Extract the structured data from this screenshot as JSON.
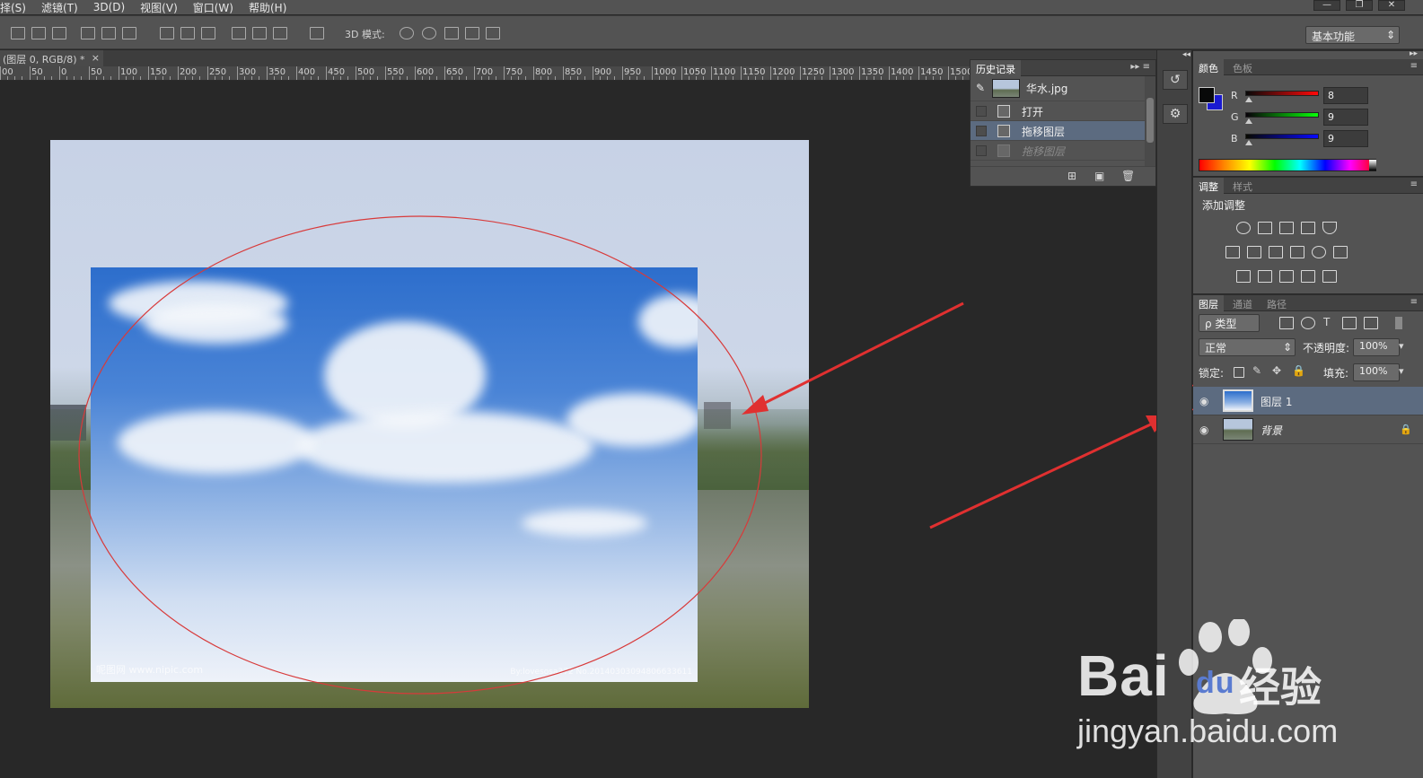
{
  "menubar": {
    "items": [
      "择(S)",
      "滤镜(T)",
      "3D(D)",
      "视图(V)",
      "窗口(W)",
      "帮助(H)"
    ],
    "window_buttons": [
      "—",
      "❐",
      "✕"
    ]
  },
  "options_bar": {
    "mode_3d_label": "3D 模式:",
    "workspace": "基本功能"
  },
  "document": {
    "tab_title": "(图层 0, RGB/8) *",
    "tab_close": "×",
    "ruler_labels": [
      "00",
      "50",
      "0",
      "50",
      "100",
      "150",
      "200",
      "250",
      "300",
      "350",
      "400",
      "450",
      "500",
      "550",
      "600",
      "650",
      "700",
      "750",
      "800",
      "850",
      "900",
      "950",
      "1000",
      "1050",
      "1100",
      "1150",
      "1200",
      "1250",
      "1300",
      "1350",
      "1400",
      "1450",
      "1500"
    ],
    "watermark_left": "呢图网 www.nipic.com",
    "watermark_right": "By:lovesosa372 No.20140303094806633611"
  },
  "history_panel": {
    "tab": "历史记录",
    "snapshot_label": "华水.jpg",
    "items": [
      {
        "label": "打开",
        "state": "normal"
      },
      {
        "label": "拖移图层",
        "state": "selected"
      },
      {
        "label": "拖移图层",
        "state": "dimmed"
      }
    ]
  },
  "color_panel": {
    "tabs": [
      "颜色",
      "色板"
    ],
    "channels": [
      {
        "label": "R",
        "value": "8",
        "color": "#cc0000"
      },
      {
        "label": "G",
        "value": "9",
        "color": "#00aa00"
      },
      {
        "label": "B",
        "value": "9",
        "color": "#0000cc"
      }
    ],
    "foreground": "#080909",
    "background_swatch": "#1a1ad0"
  },
  "adjustments_panel": {
    "tabs": [
      "调整",
      "样式"
    ],
    "heading": "添加调整"
  },
  "layers_panel": {
    "tabs": [
      "图层",
      "通道",
      "路径"
    ],
    "filter_kind": "ρ 类型",
    "blend_mode": "正常",
    "opacity_label": "不透明度:",
    "opacity_value": "100%",
    "lock_label": "锁定:",
    "fill_label": "填充:",
    "fill_value": "100%",
    "layers": [
      {
        "name": "图层 1",
        "selected": true
      },
      {
        "name": "背景",
        "locked": true
      }
    ]
  },
  "watermark": {
    "brand": "Bai",
    "brand2": "du",
    "product": "经验",
    "url": "jingyan.baidu.com"
  }
}
